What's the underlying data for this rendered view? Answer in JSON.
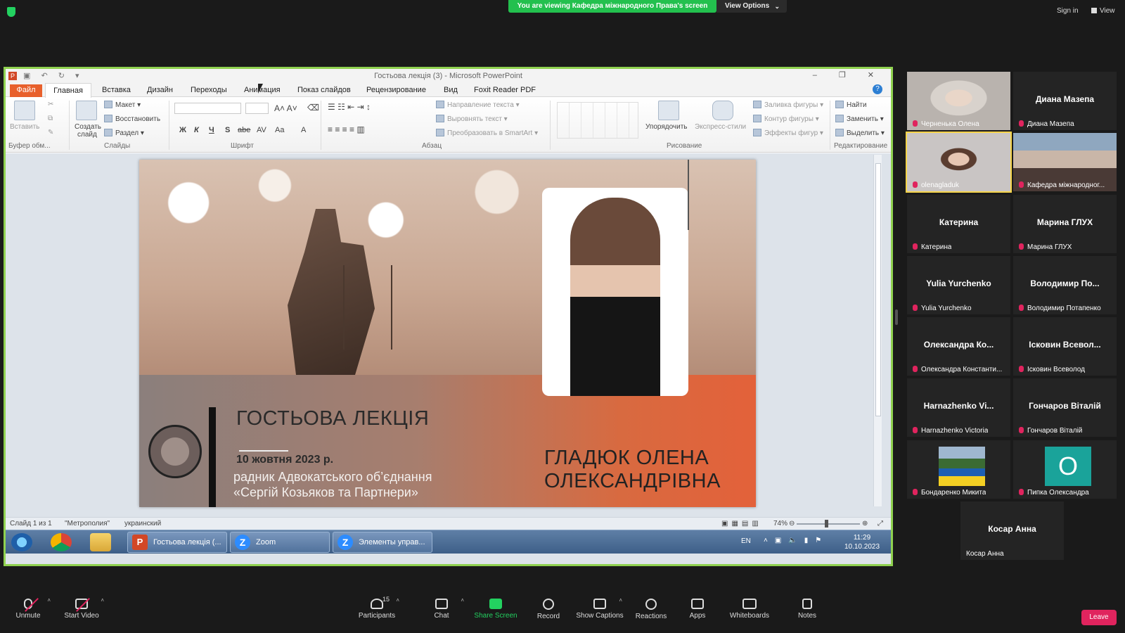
{
  "topbar": {
    "viewing_banner": "You are viewing Кафедра міжнародного Права's screen",
    "view_options": "View Options",
    "sign_in": "Sign in",
    "view": "View"
  },
  "powerpoint": {
    "window_title": "Гостьова лекція (3) - Microsoft PowerPoint",
    "tabs": [
      "Файл",
      "Главная",
      "Вставка",
      "Дизайн",
      "Переходы",
      "Анимация",
      "Показ слайдов",
      "Рецензирование",
      "Вид",
      "Foxit Reader PDF"
    ],
    "ribbon": {
      "clipboard": {
        "paste": "Вставить",
        "label": "Буфер обм..."
      },
      "slides": {
        "new_slide_1": "Создать",
        "new_slide_2": "слайд",
        "layout": "Макет",
        "reset": "Восстановить",
        "section": "Раздел",
        "label": "Слайды"
      },
      "font": {
        "bold": "Ж",
        "italic": "К",
        "underline": "Ч",
        "strike": "S",
        "abc": "abe",
        "spacing": "AV",
        "case": "Aa",
        "color": "A",
        "label": "Шрифт"
      },
      "paragraph": {
        "text_direction": "Направление текста",
        "align_text": "Выровнять текст",
        "smartart": "Преобразовать в SmartArt",
        "label": "Абзац"
      },
      "drawing": {
        "arrange": "Упорядочить",
        "quick_styles": "Экспресс-стили",
        "fill": "Заливка фигуры",
        "outline": "Контур фигуры",
        "effects": "Эффекты фигур",
        "label": "Рисование"
      },
      "editing": {
        "find": "Найти",
        "replace": "Заменить",
        "select": "Выделить",
        "label": "Редактирование"
      }
    },
    "slide": {
      "title": "ГОСТЬОВА ЛЕКЦІЯ",
      "date": "10 жовтня 2023 р.",
      "role_line1": "радник Адвокатського об’єднання",
      "role_line2": "«Сергій Козьяков та Партнери»",
      "speaker_line1": "ГЛАДЮК ОЛЕНА",
      "speaker_line2": "ОЛЕКСАНДРІВНА"
    },
    "status": {
      "slide": "Слайд 1 из 1",
      "theme": "\"Метрополия\"",
      "language": "украинский",
      "zoom": "74%"
    }
  },
  "taskbar": {
    "tasks": [
      "Гостьова лекція (...",
      "Zoom",
      "Элементы управ..."
    ],
    "lang": "EN",
    "time": "11:29",
    "date": "10.10.2023"
  },
  "participants": [
    {
      "display": "",
      "name": "Черненька Олена",
      "type": "video"
    },
    {
      "display": "Диана Мазепа",
      "name": "Диана Мазепа",
      "type": "text"
    },
    {
      "display": "",
      "name": "olenagladuk",
      "type": "video",
      "active": true
    },
    {
      "display": "",
      "name": "Кафедра міжнародног...",
      "type": "video"
    },
    {
      "display": "Катерина",
      "name": "Катерина",
      "type": "text"
    },
    {
      "display": "Марина ГЛУХ",
      "name": "Марина ГЛУХ",
      "type": "text"
    },
    {
      "display": "Yulia Yurchenko",
      "name": "Yulia Yurchenko",
      "type": "text"
    },
    {
      "display": "Володимир По...",
      "name": "Володимир Потапенко",
      "type": "text"
    },
    {
      "display": "Олександра Ко...",
      "name": "Олександра Константи...",
      "type": "text"
    },
    {
      "display": "Ісковин Всевол...",
      "name": "Ісковин Всеволод",
      "type": "text"
    },
    {
      "display": "Harnazhenko Vi...",
      "name": "Harnazhenko Victoria",
      "type": "text"
    },
    {
      "display": "Гончаров Віталій",
      "name": "Гончаров Віталій",
      "type": "text"
    },
    {
      "display": "",
      "name": "Бондаренко Микита",
      "type": "photo"
    },
    {
      "display": "O",
      "name": "Пипка Олександра",
      "type": "avatar"
    },
    {
      "display": "Косар Анна",
      "name": "Косар Анна",
      "type": "text"
    }
  ],
  "bottombar": {
    "unmute": "Unmute",
    "start_video": "Start Video",
    "participants": "Participants",
    "participant_count": "15",
    "chat": "Chat",
    "share_screen": "Share Screen",
    "record": "Record",
    "show_captions": "Show Captions",
    "reactions": "Reactions",
    "apps": "Apps",
    "whiteboards": "Whiteboards",
    "notes": "Notes",
    "leave": "Leave"
  },
  "colors": {
    "accent_green": "#23c04e",
    "share_border": "#8fd14f",
    "leave_red": "#e0245e",
    "ppt_orange": "#e8602c"
  }
}
